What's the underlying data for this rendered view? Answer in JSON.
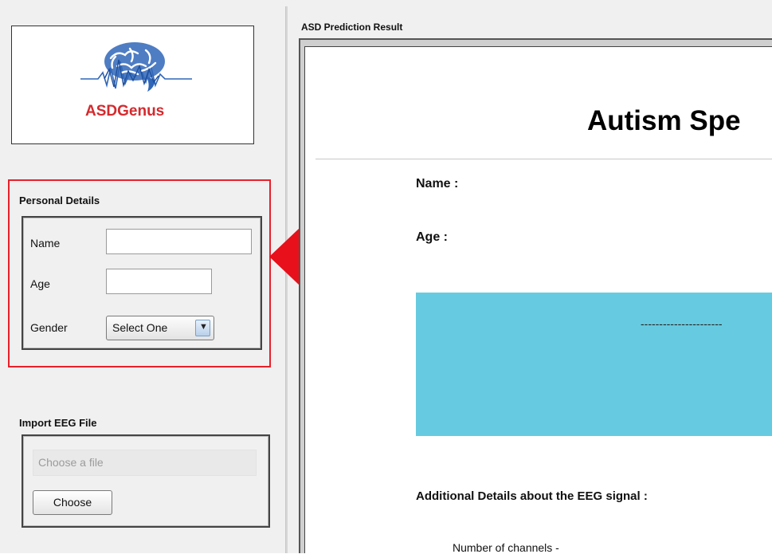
{
  "logo": {
    "text": "ASDGenus"
  },
  "personal_details": {
    "title": "Personal Details",
    "name_label": "Name",
    "name_value": "",
    "age_label": "Age",
    "age_value": "",
    "gender_label": "Gender",
    "gender_selected": "Select One"
  },
  "import_eeg": {
    "title": "Import EEG File",
    "file_placeholder": "Choose a file",
    "choose_label": "Choose"
  },
  "result": {
    "panel_title": "ASD Prediction Result",
    "heading": "Autism Spe",
    "name_label": "Name :",
    "age_label": "Age :",
    "banner_text": "----------------------",
    "details_title": "Additional Details about the EEG signal :",
    "channels_label": "Number of channels -"
  },
  "colors": {
    "highlight": "#e8202a",
    "arrow": "#e8101a",
    "banner": "#66cbe0",
    "logo_text": "#d42a2e",
    "logo_brain": "#2f66b8"
  },
  "icons": [
    "brain-eeg-logo-icon",
    "red-arrow-icon",
    "dropdown-arrow-icon"
  ]
}
